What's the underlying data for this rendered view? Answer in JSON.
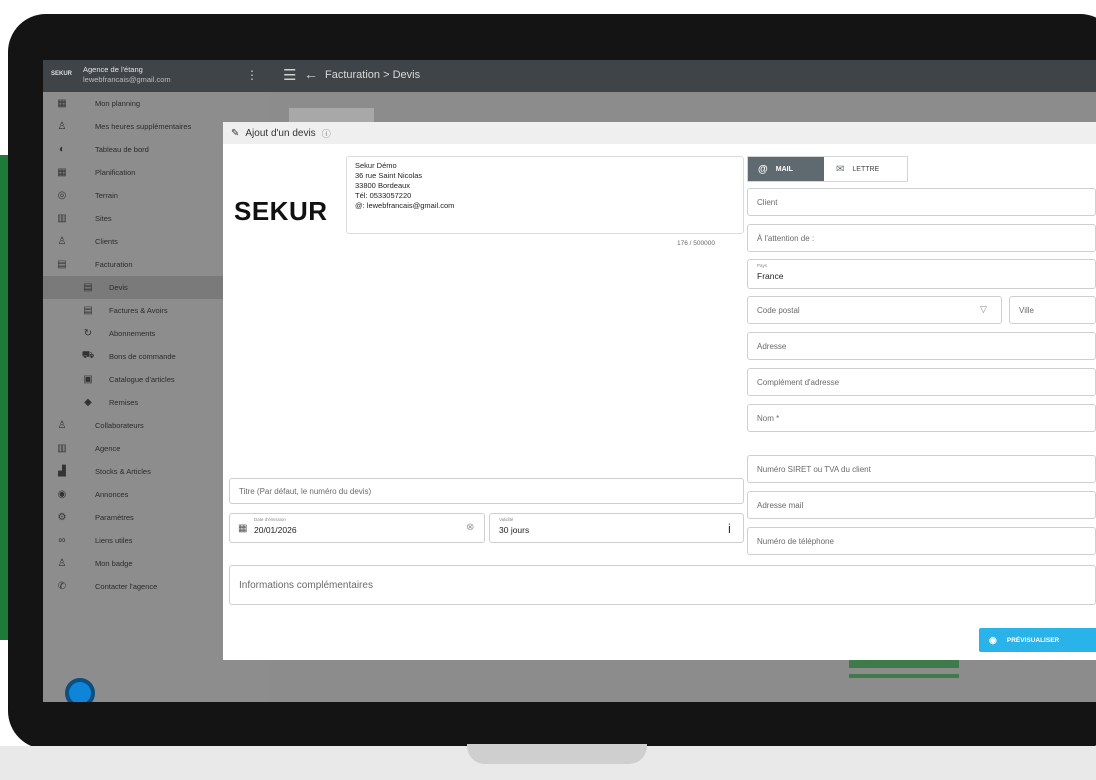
{
  "app": {
    "logo_mini": "SEKUR",
    "agency_name": "Agence de l'étang",
    "agency_email": "lewebfrancais@gmail.com",
    "breadcrumb": "Facturation  >  Devis"
  },
  "sidebar": {
    "items": [
      {
        "label": "Mon planning",
        "icon": "calendar-icon"
      },
      {
        "label": "Mes heures supplémentaires",
        "icon": "user-clock-icon"
      },
      {
        "label": "Tableau de bord",
        "icon": "dashboard-icon"
      },
      {
        "label": "Planification",
        "icon": "calendar-grid-icon"
      },
      {
        "label": "Terrain",
        "icon": "compass-icon"
      },
      {
        "label": "Sites",
        "icon": "building-icon"
      },
      {
        "label": "Clients",
        "icon": "person-icon"
      },
      {
        "label": "Facturation",
        "icon": "document-icon"
      },
      {
        "label": "Devis",
        "icon": "document-icon"
      },
      {
        "label": "Factures & Avoirs",
        "icon": "document-icon"
      },
      {
        "label": "Abonnements",
        "icon": "refresh-icon"
      },
      {
        "label": "Bons de commande",
        "icon": "cart-icon"
      },
      {
        "label": "Catalogue d'articles",
        "icon": "book-icon"
      },
      {
        "label": "Remises",
        "icon": "tag-icon"
      },
      {
        "label": "Collaborateurs",
        "icon": "person-icon"
      },
      {
        "label": "Agence",
        "icon": "building-icon"
      },
      {
        "label": "Stocks & Articles",
        "icon": "boxes-icon"
      },
      {
        "label": "Annonces",
        "icon": "chat-icon"
      },
      {
        "label": "Paramètres",
        "icon": "settings-icon"
      },
      {
        "label": "Liens utiles",
        "icon": "link-icon"
      },
      {
        "label": "Mon badge",
        "icon": "badge-icon"
      },
      {
        "label": "Contacter l'agence",
        "icon": "phone-icon"
      }
    ]
  },
  "dialog": {
    "title": "Ajout d'un devis",
    "brand": "SEKUR",
    "company_address": [
      "Sekur Démo",
      "36 rue Saint Nicolas",
      "33800 Bordeaux",
      "Tél: 0533057220",
      "@: lewebfrancais@gmail.com"
    ],
    "counter": "176 / 500000",
    "title_placeholder": "Titre (Par défaut, le numéro du devis)",
    "date_label": "Date d'émission",
    "date_value": "20/01/2026",
    "validity_label": "Validité",
    "validity_value": "30 jours",
    "info_placeholder": "Informations complémentaires",
    "tabs": {
      "mail": "MAIL",
      "letter": "LETTRE"
    },
    "client_fields": {
      "client": "Client",
      "attention": "À l'attention de :",
      "country_label": "Pays",
      "country_value": "France",
      "postal_code": "Code postal",
      "city": "Ville",
      "address": "Adresse",
      "address_complement": "Complément d'adresse",
      "name": "Nom *",
      "siret": "Numéro SIRET ou TVA du client",
      "email": "Adresse mail",
      "phone": "Numéro de téléphone"
    },
    "preview_button": "PRÉVISUALISER"
  }
}
